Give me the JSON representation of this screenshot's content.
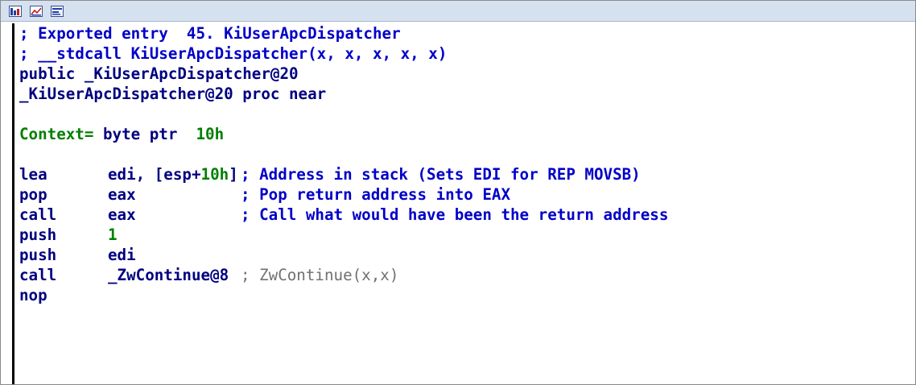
{
  "toolbar": {
    "icons": [
      "graph-view-icon",
      "flow-chart-icon",
      "hex-view-icon"
    ]
  },
  "header_lines": [
    "; Exported entry  45. KiUserApcDispatcher",
    "; __stdcall KiUserApcDispatcher(x, x, x, x, x)",
    "public _KiUserApcDispatcher@20",
    "_KiUserApcDispatcher@20 proc near"
  ],
  "context": {
    "name": "Context=",
    "type": " byte ptr  ",
    "offset": "10h"
  },
  "instructions": [
    {
      "mnemonic": "lea",
      "op_pre": "edi, [esp+",
      "op_num": "10h",
      "op_post": "]",
      "comment": "; Address in stack (Sets EDI for REP MOVSB)"
    },
    {
      "mnemonic": "pop",
      "op_pre": "eax",
      "op_num": "",
      "op_post": "",
      "comment": "; Pop return address into EAX"
    },
    {
      "mnemonic": "call",
      "op_pre": "eax",
      "op_num": "",
      "op_post": "",
      "comment": "; Call what would have been the return address"
    },
    {
      "mnemonic": "push",
      "op_pre": "",
      "op_num": "1",
      "op_post": "",
      "comment": ""
    },
    {
      "mnemonic": "push",
      "op_pre": "edi",
      "op_num": "",
      "op_post": "",
      "comment": ""
    },
    {
      "mnemonic": "call",
      "op_pre": "_ZwContinue@8",
      "op_num": "",
      "op_post": "",
      "comment": "; ZwContinue(x,x)"
    },
    {
      "mnemonic": "nop",
      "op_pre": "",
      "op_num": "",
      "op_post": "",
      "comment": ""
    }
  ],
  "colors": {
    "code": "#000080",
    "number": "#008000",
    "comment": "#0000c8",
    "auto_comment": "#707070",
    "titlebar": "#d6e1f0"
  }
}
